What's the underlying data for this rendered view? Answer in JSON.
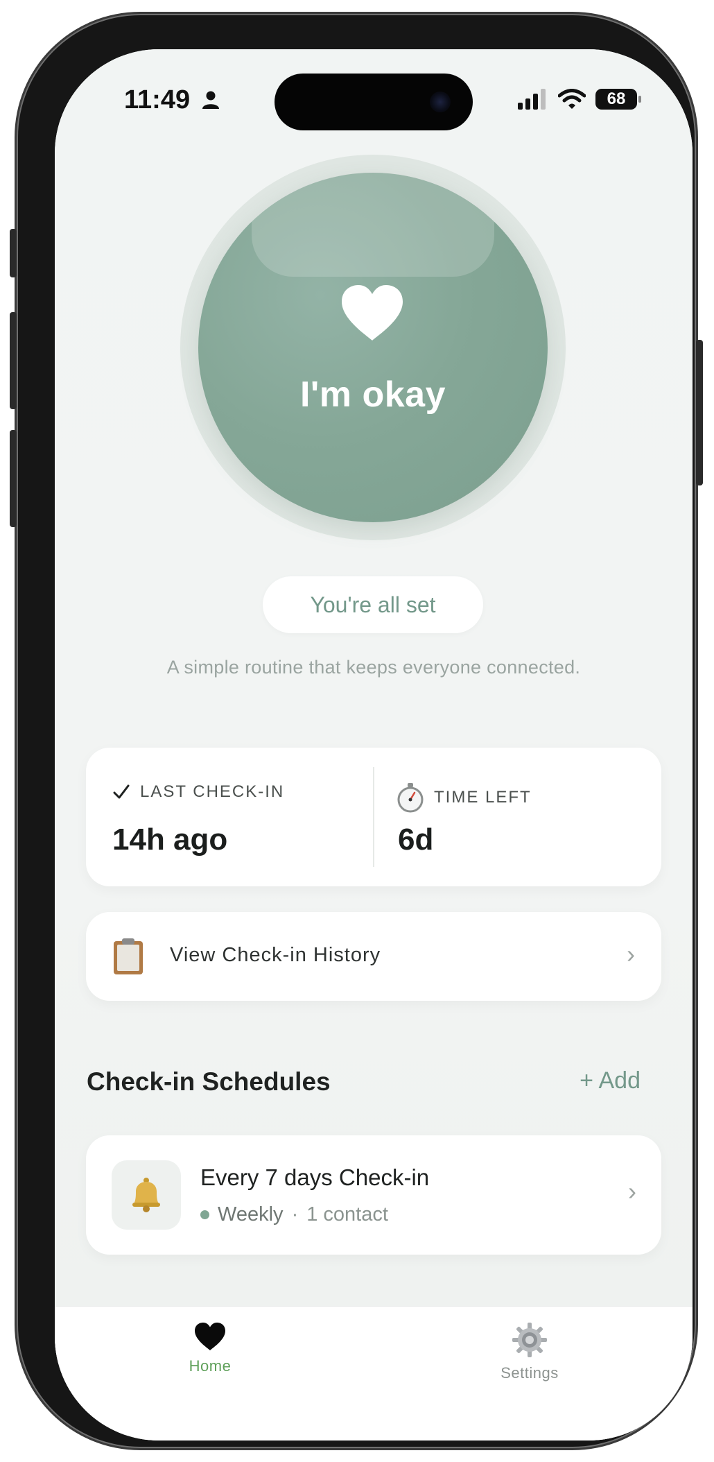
{
  "status_bar": {
    "time": "11:49",
    "battery": "68"
  },
  "hero": {
    "button_label": "I'm okay",
    "status_pill": "You're all set",
    "subtitle": "A simple routine that keeps everyone connected."
  },
  "stats": {
    "last_checkin_label": "LAST CHECK-IN",
    "last_checkin_value": "14h ago",
    "time_left_label": "TIME LEFT",
    "time_left_value": "6d"
  },
  "history": {
    "label": "View Check-in History"
  },
  "schedules": {
    "title": "Check-in Schedules",
    "add_label": "+ Add",
    "items": [
      {
        "title": "Every 7 days Check-in",
        "frequency": "Weekly",
        "separator": "·",
        "contacts": "1 contact"
      }
    ]
  },
  "tabs": [
    {
      "label": "Home",
      "active": true
    },
    {
      "label": "Settings",
      "active": false
    }
  ],
  "colors": {
    "accent": "#73988a",
    "button_green": "#85a797",
    "tab_active": "#5fa05a"
  },
  "icons": {
    "status_person": "person-icon",
    "heart": "heart-icon",
    "check": "checkmark-icon",
    "stopwatch": "stopwatch-icon",
    "clipboard": "clipboard-icon",
    "bell": "bell-icon",
    "settings": "gear-icon"
  }
}
